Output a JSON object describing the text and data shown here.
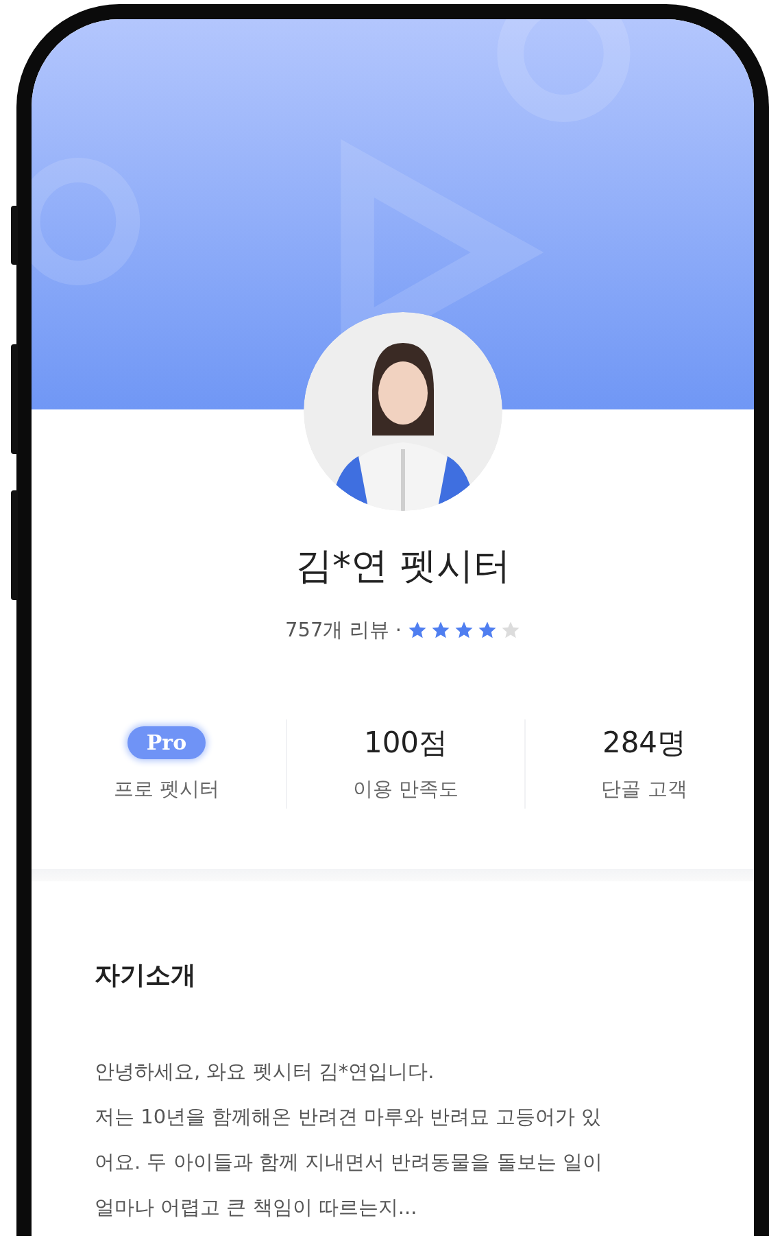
{
  "profile": {
    "name": "김*연 펫시터",
    "reviews": "757개 리뷰 ·",
    "stars": 4
  },
  "stats": [
    {
      "kind": "badge",
      "value": "Pro",
      "label": "프로 펫시터"
    },
    {
      "kind": "number",
      "value": "100점",
      "label": "이용 만족도"
    },
    {
      "kind": "number",
      "value": "284명",
      "label": "단골 고객"
    }
  ],
  "intro": {
    "title": "자기소개",
    "lines": [
      "안녕하세요, 와요 펫시터 김*연입니다.",
      "저는 10년을 함께해온 반려견 마루와 반려묘 고등어가 있",
      "어요. 두 아이들과 함께 지내면서 반려동물을 돌보는 일이",
      "얼마나 어렵고 큰 책임이 따르는지..."
    ]
  }
}
